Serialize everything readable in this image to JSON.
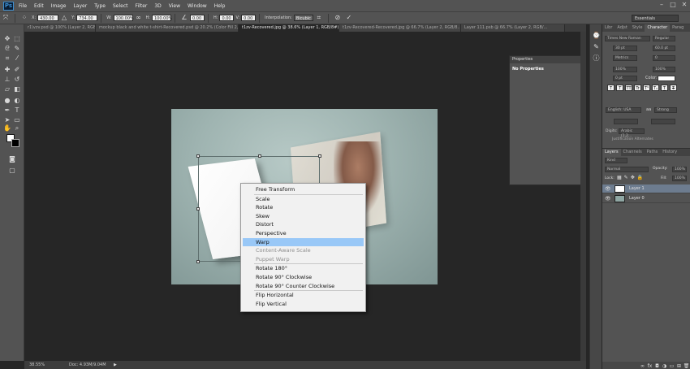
{
  "app": {
    "logo": "Ps"
  },
  "menu": [
    "File",
    "Edit",
    "Image",
    "Layer",
    "Type",
    "Select",
    "Filter",
    "3D",
    "View",
    "Window",
    "Help"
  ],
  "options": {
    "x_label": "X:",
    "x_value": "430.00 px",
    "y_label": "Y:",
    "y_value": "734.00 px",
    "w_label": "W:",
    "w_value": "100.00%",
    "h_label": "H:",
    "h_value": "100.00%",
    "angle_value": "0.00",
    "hskew_label": "H:",
    "hskew_value": "0.00",
    "vskew_label": "V:",
    "vskew_value": "0.00",
    "interp_label": "Interpolation:",
    "interp_value": "Bicubic",
    "workspace": "Essentials"
  },
  "tabs": [
    {
      "label": "r1\\vzv.psd @ 100% (Layer 2, RGB/8...",
      "active": false
    },
    {
      "label": "mockup black and white t-shirt-Recovered.psd @ 20.2% (Color Fill 2, RGB...",
      "active": false
    },
    {
      "label": "t1zv-Recovered.jpg @ 38.6% (Layer 1, RGB/8#) *",
      "active": true
    },
    {
      "label": "t1zv-Recovered-Recovered.jpg @ 66.7% (Layer 2, RGB/8...",
      "active": false
    },
    {
      "label": "Layer 111.psb @ 66.7% (Layer 2, RGB/...",
      "active": false
    }
  ],
  "context_menu": {
    "items": [
      {
        "label": "Free Transform",
        "state": "normal"
      },
      {
        "sep": true
      },
      {
        "label": "Scale",
        "state": "normal"
      },
      {
        "label": "Rotate",
        "state": "normal"
      },
      {
        "label": "Skew",
        "state": "normal"
      },
      {
        "label": "Distort",
        "state": "normal"
      },
      {
        "label": "Perspective",
        "state": "normal"
      },
      {
        "label": "Warp",
        "state": "highlight"
      },
      {
        "label": "Content-Aware Scale",
        "state": "disabled"
      },
      {
        "label": "Puppet Warp",
        "state": "disabled"
      },
      {
        "sep": true
      },
      {
        "label": "Rotate 180°",
        "state": "normal"
      },
      {
        "label": "Rotate 90° Clockwise",
        "state": "normal"
      },
      {
        "label": "Rotate 90° Counter Clockwise",
        "state": "normal"
      },
      {
        "sep": true
      },
      {
        "label": "Flip Horizontal",
        "state": "normal"
      },
      {
        "label": "Flip Vertical",
        "state": "normal"
      }
    ]
  },
  "status": {
    "zoom": "38.55%",
    "doc": "Doc: 4.93M/9.04M",
    "arrow": "▶"
  },
  "properties": {
    "title": "Properties",
    "body": "No Properties"
  },
  "right_tabs": [
    "Libr",
    "Adjst",
    "Style",
    "Character",
    "Parag"
  ],
  "right_active_tab": "Character",
  "character": {
    "font_family": "Times New Roman",
    "font_style": "Regular",
    "font_size": "30 pt",
    "leading": "60.0 pt",
    "tracking": "Metrics",
    "kerning": "0",
    "v_scale": "100%",
    "h_scale": "100%",
    "baseline": "0 pt",
    "color_label": "Color:",
    "style_buttons": [
      "T",
      "T",
      "TT",
      "Tr",
      "T¹",
      "T₁",
      "T",
      "T"
    ],
    "language": "English: USA",
    "antialias": "Strong",
    "aa_label": "aa",
    "digits_label": "Digits:",
    "digits_value": "Arabic (1,2...",
    "justification": "Justification Alternates"
  },
  "layers_tabs": [
    "Layers",
    "Channels",
    "Paths",
    "History"
  ],
  "layers_active_tab": "Layers",
  "layers": {
    "kind": "Kind",
    "blend": "Normal",
    "opacity_label": "Opacity:",
    "opacity": "100%",
    "lock_label": "Lock:",
    "fill_label": "Fill:",
    "fill": "100%",
    "items": [
      {
        "name": "Layer 1",
        "selected": true
      },
      {
        "name": "Layer 0",
        "selected": false
      }
    ]
  }
}
